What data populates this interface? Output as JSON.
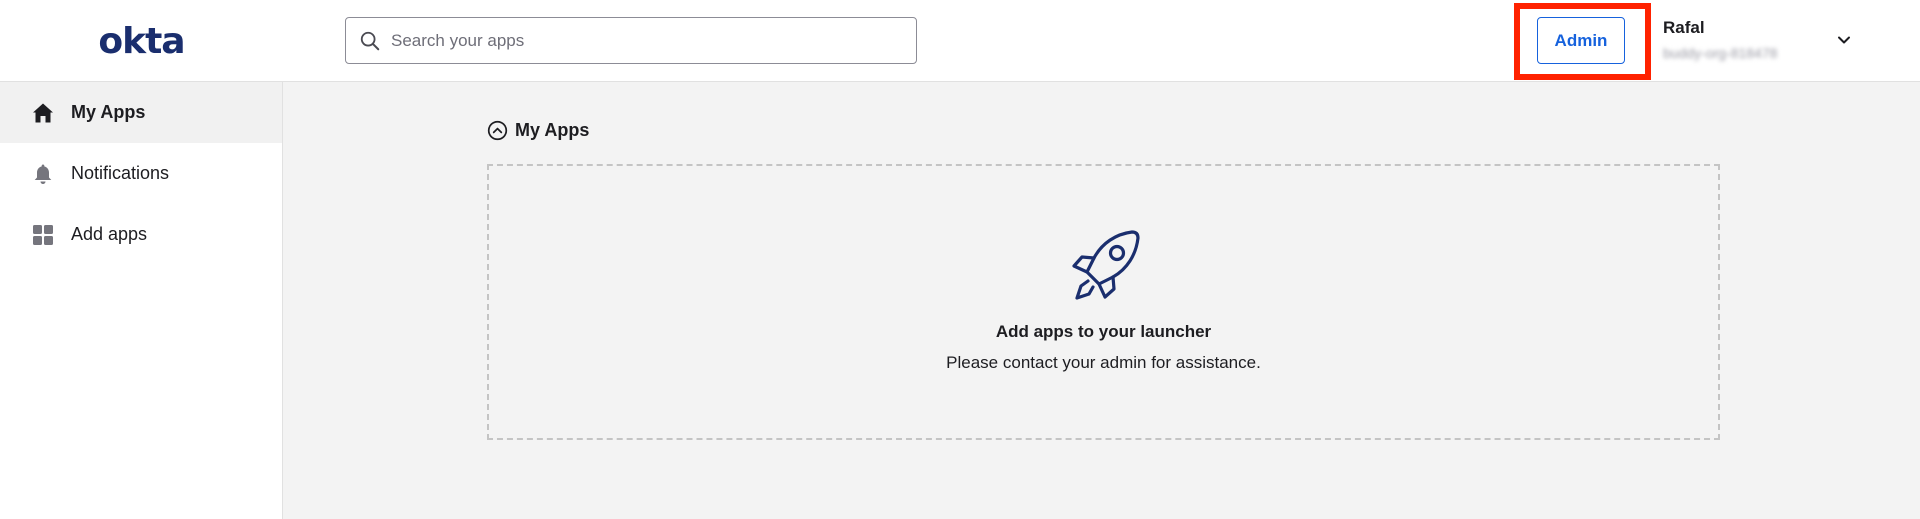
{
  "header": {
    "logo": "okta",
    "search": {
      "placeholder": "Search your apps",
      "value": ""
    },
    "admin_button": "Admin",
    "user": {
      "name": "Rafal",
      "org": "buddy-org-818478"
    },
    "icons": [
      "search-icon",
      "chevron-down-icon"
    ]
  },
  "sidebar": {
    "items": [
      {
        "label": "My Apps",
        "icon": "home-icon",
        "active": true
      },
      {
        "label": "Notifications",
        "icon": "bell-icon",
        "active": false
      },
      {
        "label": "Add apps",
        "icon": "grid-icon",
        "active": false
      }
    ]
  },
  "main": {
    "section_title": "My Apps",
    "empty_state": {
      "title": "Add apps to your launcher",
      "subtitle": "Please contact your admin for assistance.",
      "icon": "rocket-icon"
    }
  },
  "colors": {
    "brand": "#1a2e6e",
    "accent": "#1662dd",
    "highlight": "#ff2200",
    "content_bg": "#f3f3f3"
  }
}
